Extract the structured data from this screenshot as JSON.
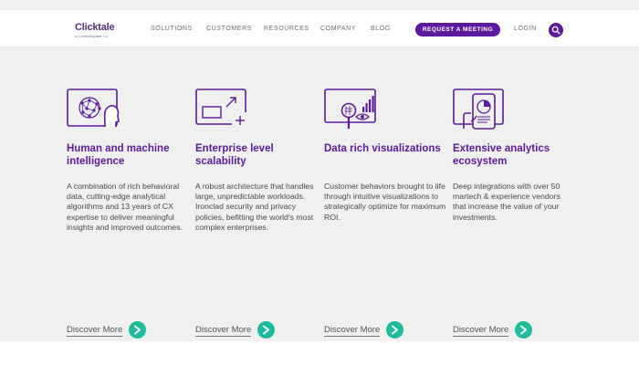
{
  "header": {
    "logo": {
      "name": "Clicktale",
      "tagline": "a Contentsquare Co."
    },
    "nav_items": [
      {
        "label": "SOLUTIONS"
      },
      {
        "label": "CUSTOMERS"
      },
      {
        "label": "RESOURCES"
      },
      {
        "label": "COMPANY"
      },
      {
        "label": "BLOG"
      }
    ],
    "cta_label": "REQUEST A MEETING",
    "login_label": "LOGIN",
    "search_icon": "magnifier-icon"
  },
  "colors": {
    "brand_purple": "#5c1a9e",
    "accent_teal": "#1ebc9c",
    "page_background": "#f0f0f0"
  },
  "features": [
    {
      "icon": "ai-head-icon",
      "title": "Human and machine intelligence",
      "description": "A combination of rich behavioral data, cutting-edge analytical algorithms and 13 years of CX expertise to deliver meaningful insights and improved outcomes.",
      "link_label": "Discover More",
      "link_icon": "arrow-right-icon"
    },
    {
      "icon": "scale-window-icon",
      "title": "Enterprise level scalability",
      "description": "A robust architecture that handles large, unpredictable workloads. Ironclad security and privacy policies, befitting the world's most complex enterprises.",
      "link_label": "Discover More",
      "link_icon": "arrow-right-icon"
    },
    {
      "icon": "data-visualization-icon",
      "title": "Data rich visualizations",
      "description": "Customer behaviors brought to life through intuitive visualizations to strategically optimize for maximum ROI.",
      "link_label": "Discover More",
      "link_icon": "arrow-right-icon"
    },
    {
      "icon": "analytics-ecosystem-icon",
      "title": "Extensive analytics ecosystem",
      "description": "Deep integrations with over 50 martech & experience vendors that increase the value of your investments.",
      "link_label": "Discover More",
      "link_icon": "arrow-right-icon"
    }
  ]
}
